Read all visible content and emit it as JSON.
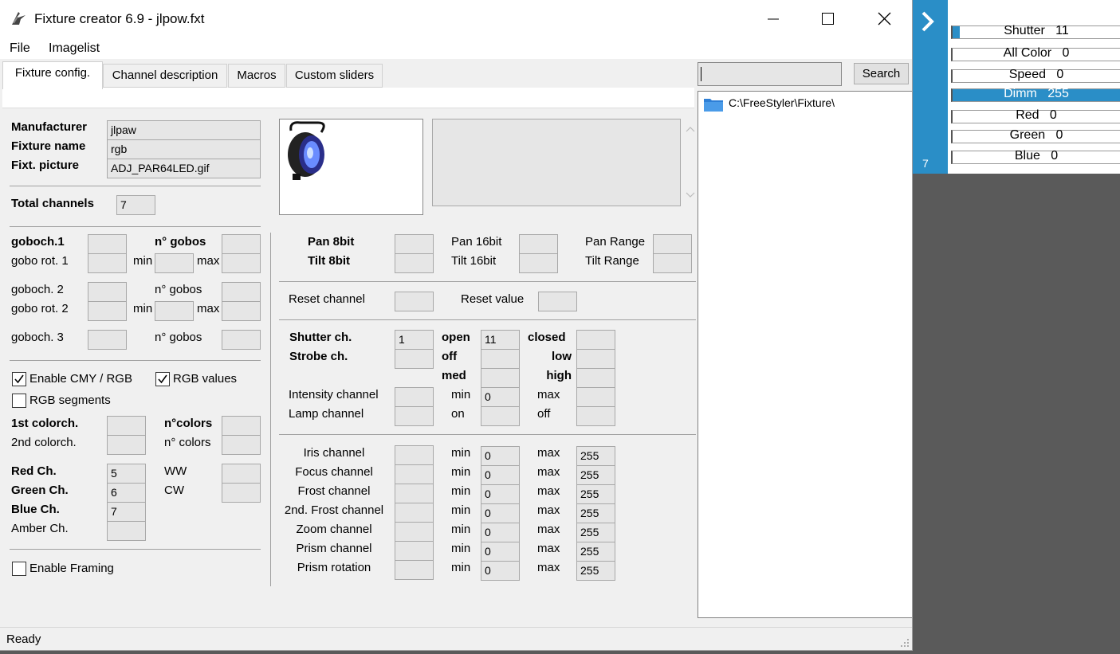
{
  "window": {
    "title": "Fixture creator 6.9 - jlpow.fxt"
  },
  "menu": [
    "File",
    "Imagelist"
  ],
  "tabs": [
    "Fixture config.",
    "Channel description",
    "Macros",
    "Custom sliders"
  ],
  "search": {
    "button": "Search",
    "value": ""
  },
  "tree": {
    "root": "C:\\FreeStyler\\Fixture\\"
  },
  "status": "Ready",
  "fixture": {
    "manufacturer_label": "Manufacturer",
    "manufacturer": "jlpaw",
    "name_label": "Fixture name",
    "name": "rgb",
    "picture_label": "Fixt. picture",
    "picture": "ADJ_PAR64LED.gif",
    "total_label": "Total channels",
    "total": "7"
  },
  "gobo": {
    "goboch1": "goboch.1",
    "ngobos_bold": "n° gobos",
    "rot1": "gobo rot. 1",
    "goboch2": "goboch. 2",
    "ngobos2": "n° gobos",
    "rot2": "gobo rot. 2",
    "goboch3": "goboch. 3",
    "ngobos3": "n° gobos",
    "min": "min",
    "max": "max"
  },
  "color": {
    "enable_cmy": "Enable CMY / RGB",
    "rgb_values": "RGB values",
    "rgb_segments": "RGB segments",
    "colorch1": "1st colorch.",
    "ncolors_bold": "n°colors",
    "colorch2": "2nd colorch.",
    "ncolors2": "n° colors",
    "red_label": "Red Ch.",
    "red": "5",
    "green_label": "Green Ch.",
    "green": "6",
    "blue_label": "Blue Ch.",
    "blue": "7",
    "amber_label": "Amber Ch.",
    "ww": "WW",
    "cw": "CW",
    "enable_framing": "Enable Framing"
  },
  "pantilt": {
    "pan8": "Pan 8bit",
    "tilt8": "Tilt 8bit",
    "pan16": "Pan 16bit",
    "tilt16": "Tilt 16bit",
    "panrange": "Pan Range",
    "tiltrange": "Tilt Range"
  },
  "reset": {
    "channel": "Reset channel",
    "value": "Reset value"
  },
  "shutter": {
    "shutter_label": "Shutter ch.",
    "shutter": "1",
    "open_label": "open",
    "open": "11",
    "closed_label": "closed",
    "strobe_label": "Strobe ch.",
    "off_label": "off",
    "low_label": "low",
    "med_label": "med",
    "high_label": "high",
    "intensity_label": "Intensity channel",
    "intensity_min": "0",
    "lamp_label": "Lamp channel",
    "on_label": "on",
    "lamp_off": "off",
    "min": "min",
    "max": "max"
  },
  "effects": [
    {
      "label": "Iris channel",
      "min": "0",
      "max": "255"
    },
    {
      "label": "Focus channel",
      "min": "0",
      "max": "255"
    },
    {
      "label": "Frost channel",
      "min": "0",
      "max": "255"
    },
    {
      "label": "2nd. Frost channel",
      "min": "0",
      "max": "255"
    },
    {
      "label": "Zoom channel",
      "min": "0",
      "max": "255"
    },
    {
      "label": "Prism channel",
      "min": "0",
      "max": "255"
    },
    {
      "label": "Prism rotation",
      "min": "0",
      "max": "255"
    }
  ],
  "effects_min_label": "min",
  "effects_max_label": "max",
  "side_panel": {
    "count": "7",
    "accent": "#2a8ec7",
    "sliders": [
      {
        "name": "Shutter",
        "value": "11",
        "level": 0.043
      },
      {
        "name": "All Color",
        "value": "0",
        "level": 0
      },
      {
        "name": "Speed",
        "value": "0",
        "level": 0
      },
      {
        "name": "Dimm",
        "value": "255",
        "level": 1
      },
      {
        "name": "Red",
        "value": "0",
        "level": 0
      },
      {
        "name": "Green",
        "value": "0",
        "level": 0
      },
      {
        "name": "Blue",
        "value": "0",
        "level": 0
      }
    ]
  }
}
